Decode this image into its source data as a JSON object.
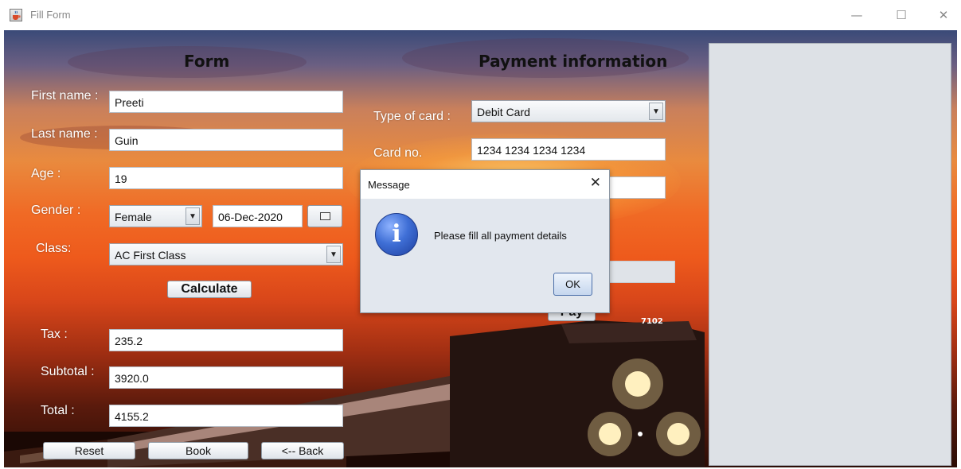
{
  "window": {
    "title": "Fill Form",
    "controls": {
      "minimize": "—",
      "maximize": "☐",
      "close": "✕"
    }
  },
  "form": {
    "heading": "Form",
    "first_name_label": "First name :",
    "first_name_value": "Preeti",
    "last_name_label": "Last name :",
    "last_name_value": "Guin",
    "age_label": "Age :",
    "age_value": "19",
    "gender_label": "Gender :",
    "gender_value": "Female",
    "date_value": "06-Dec-2020",
    "class_label": "Class:",
    "class_value": "AC First Class",
    "calculate_label": "Calculate",
    "tax_label": "Tax :",
    "tax_value": "235.2",
    "subtotal_label": "Subtotal :",
    "subtotal_value": "3920.0",
    "total_label": "Total :",
    "total_value": "4155.2",
    "reset_label": "Reset",
    "book_label": "Book",
    "back_label": "<-- Back"
  },
  "payment": {
    "heading": "Payment information",
    "card_type_label": "Type of card :",
    "card_type_value": "Debit Card",
    "card_no_label": "Card no.",
    "card_no_value": "1234 1234 1234 1234",
    "pay_label": "Pay"
  },
  "dialog": {
    "title": "Message",
    "message": "Please fill all payment details",
    "ok_label": "OK",
    "close": "✕"
  },
  "icons": {
    "app": "java-cup-icon",
    "info": "info-icon",
    "calendar": "calendar-icon",
    "dropdown": "chevron-down-icon"
  },
  "train_number": "7102"
}
